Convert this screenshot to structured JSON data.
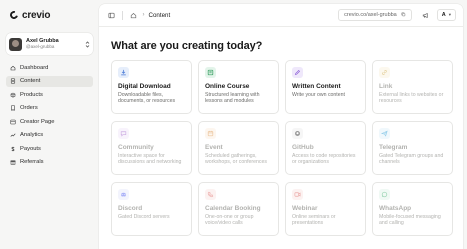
{
  "app": {
    "name": "crevio"
  },
  "user": {
    "name": "Axel Grubba",
    "handle": "@axel-grubba",
    "initial": "A"
  },
  "nav": [
    {
      "label": "Dashboard",
      "icon": "home-icon",
      "active": false
    },
    {
      "label": "Content",
      "icon": "file-icon",
      "active": true
    },
    {
      "label": "Products",
      "icon": "box-icon",
      "active": false
    },
    {
      "label": "Orders",
      "icon": "receipt-icon",
      "active": false
    },
    {
      "label": "Creator Page",
      "icon": "layout-icon",
      "active": false
    },
    {
      "label": "Analytics",
      "icon": "chart-icon",
      "active": false
    },
    {
      "label": "Payouts",
      "icon": "dollar-icon",
      "active": false
    },
    {
      "label": "Referrals",
      "icon": "gift-icon",
      "active": false
    }
  ],
  "topbar": {
    "breadcrumb_current": "Content",
    "url": "crevio.co/axel-grubba"
  },
  "main": {
    "heading": "What are you creating today?"
  },
  "cards": [
    {
      "title": "Digital Download",
      "desc": "Downloadable files, documents, or resources",
      "icon": "download-icon",
      "color": "#4b7bd6",
      "bg": "#e6eefb",
      "enabled": true
    },
    {
      "title": "Online Course",
      "desc": "Structured learning with lessons and modules",
      "icon": "course-icon",
      "color": "#2f9a5b",
      "bg": "#e3f4ea",
      "enabled": true
    },
    {
      "title": "Written Content",
      "desc": "Write your own content",
      "icon": "pen-icon",
      "color": "#8a5cd6",
      "bg": "#efe8fb",
      "enabled": true
    },
    {
      "title": "Link",
      "desc": "External links to websites or resources",
      "icon": "link-icon",
      "color": "#c9a23c",
      "bg": "#fbf3df",
      "enabled": false
    },
    {
      "title": "Community",
      "desc": "Interactive space for discussions and networking",
      "icon": "chat-icon",
      "color": "#9b59c6",
      "bg": "#f3e9fa",
      "enabled": false
    },
    {
      "title": "Event",
      "desc": "Scheduled gatherings, workshops, or conferences",
      "icon": "calendar-icon",
      "color": "#d98a3a",
      "bg": "#fcefe0",
      "enabled": false
    },
    {
      "title": "GitHub",
      "desc": "Access to code repositories or organizations",
      "icon": "github-icon",
      "color": "#333333",
      "bg": "#eeeeee",
      "enabled": false
    },
    {
      "title": "Telegram",
      "desc": "Gated Telegram groups and channels",
      "icon": "send-icon",
      "color": "#2e9fd6",
      "bg": "#e2f2fb",
      "enabled": false
    },
    {
      "title": "Discord",
      "desc": "Gated Discord servers",
      "icon": "discord-icon",
      "color": "#5865f2",
      "bg": "#e8eafd",
      "enabled": false
    },
    {
      "title": "Calendar Booking",
      "desc": "One-on-one or group voice/video calls",
      "icon": "phone-icon",
      "color": "#d9534f",
      "bg": "#fbe6e5",
      "enabled": false
    },
    {
      "title": "Webinar",
      "desc": "Online seminars or presentations",
      "icon": "video-icon",
      "color": "#d9534f",
      "bg": "#fbe6e5",
      "enabled": false
    },
    {
      "title": "WhatsApp",
      "desc": "Mobile-focused messaging and calling",
      "icon": "whatsapp-icon",
      "color": "#25a35a",
      "bg": "#e2f5ea",
      "enabled": false
    }
  ]
}
